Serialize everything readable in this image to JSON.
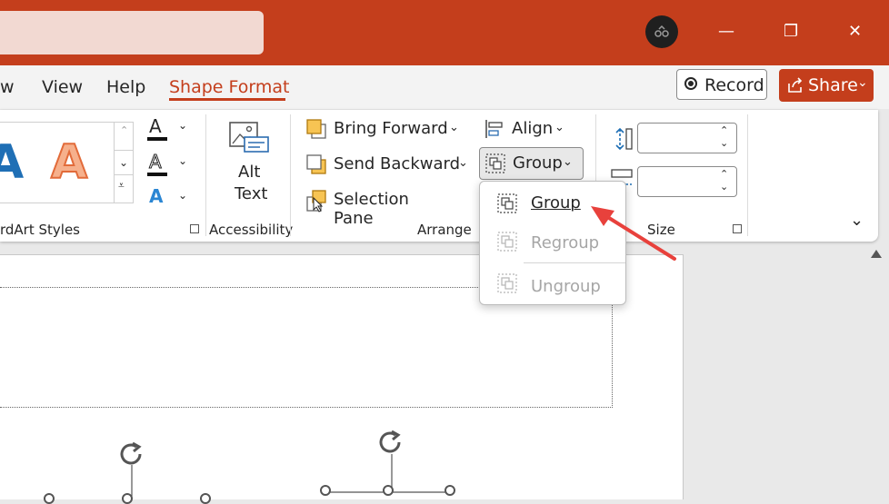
{
  "titlebar": {
    "minimize_glyph": "—",
    "restore_glyph": "❐",
    "close_glyph": "✕"
  },
  "tabs": {
    "view": "w",
    "view2": "View",
    "help": "Help",
    "shape_format": "Shape Format"
  },
  "actions": {
    "record": "Record",
    "share": "Share"
  },
  "ribbon": {
    "wordart_group": "rdArt Styles",
    "accessibility_group": "Accessibility",
    "alt_text_line1": "Alt",
    "alt_text_line2": "Text",
    "arrange_group": "Arrange",
    "bring_forward": "Bring Forward",
    "send_backward": "Send Backward",
    "selection_pane": "Selection Pane",
    "align": "Align",
    "group": "Group",
    "size_group": "Size"
  },
  "group_menu": {
    "items": [
      {
        "label": "Group",
        "enabled": true
      },
      {
        "label": "Regroup",
        "enabled": false
      },
      {
        "label": "Ungroup",
        "enabled": false
      }
    ]
  },
  "colors": {
    "accent": "#c43e1c",
    "annotation_arrow": "#e8413c"
  }
}
